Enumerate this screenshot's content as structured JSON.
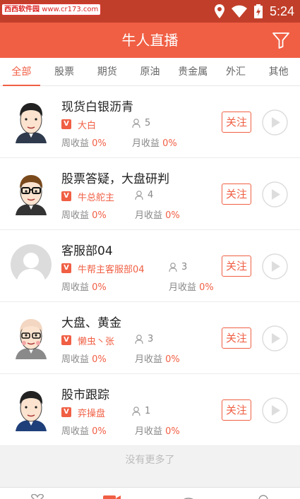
{
  "status_bar": {
    "watermark_name": "西西软件园",
    "watermark_url": "www.cr173.com",
    "time": "5:24"
  },
  "header": {
    "title": "牛人直播"
  },
  "tabs": [
    {
      "label": "全部",
      "active": true
    },
    {
      "label": "股票",
      "active": false
    },
    {
      "label": "期货",
      "active": false
    },
    {
      "label": "原油",
      "active": false
    },
    {
      "label": "贵金属",
      "active": false
    },
    {
      "label": "外汇",
      "active": false
    },
    {
      "label": "其他",
      "active": false
    }
  ],
  "items": [
    {
      "title": "现货白银沥青",
      "host": "大白",
      "fans": "5",
      "week_label": "周收益",
      "week_value": "0%",
      "month_label": "月收益",
      "month_value": "0%",
      "follow_label": "关注",
      "avatar": "avatar-cartoon-man-1"
    },
    {
      "title": "股票答疑，大盘研判",
      "host": "牛总舵主",
      "fans": "4",
      "week_label": "周收益",
      "week_value": "0%",
      "month_label": "月收益",
      "month_value": "0%",
      "follow_label": "关注",
      "avatar": "avatar-cartoon-man-glasses"
    },
    {
      "title": "客服部04",
      "host": "牛帮主客服部04",
      "fans": "3",
      "week_label": "周收益",
      "week_value": "0%",
      "month_label": "月收益",
      "month_value": "0%",
      "follow_label": "关注",
      "avatar": "avatar-default"
    },
    {
      "title": "大盘、黄金",
      "host": "懒虫丶张",
      "fans": "3",
      "week_label": "周收益",
      "week_value": "0%",
      "month_label": "月收益",
      "month_value": "0%",
      "follow_label": "关注",
      "avatar": "avatar-cartoon-man-bald"
    },
    {
      "title": "股市跟踪",
      "host": "弈操盘",
      "fans": "1",
      "week_label": "周收益",
      "week_value": "0%",
      "month_label": "月收益",
      "month_value": "0%",
      "follow_label": "关注",
      "avatar": "avatar-cartoon-man-suit"
    }
  ],
  "badge_letter": "V",
  "footer": {
    "no_more": "没有更多了"
  },
  "colors": {
    "accent": "#f05f44",
    "status_bar": "#c13f2a"
  }
}
